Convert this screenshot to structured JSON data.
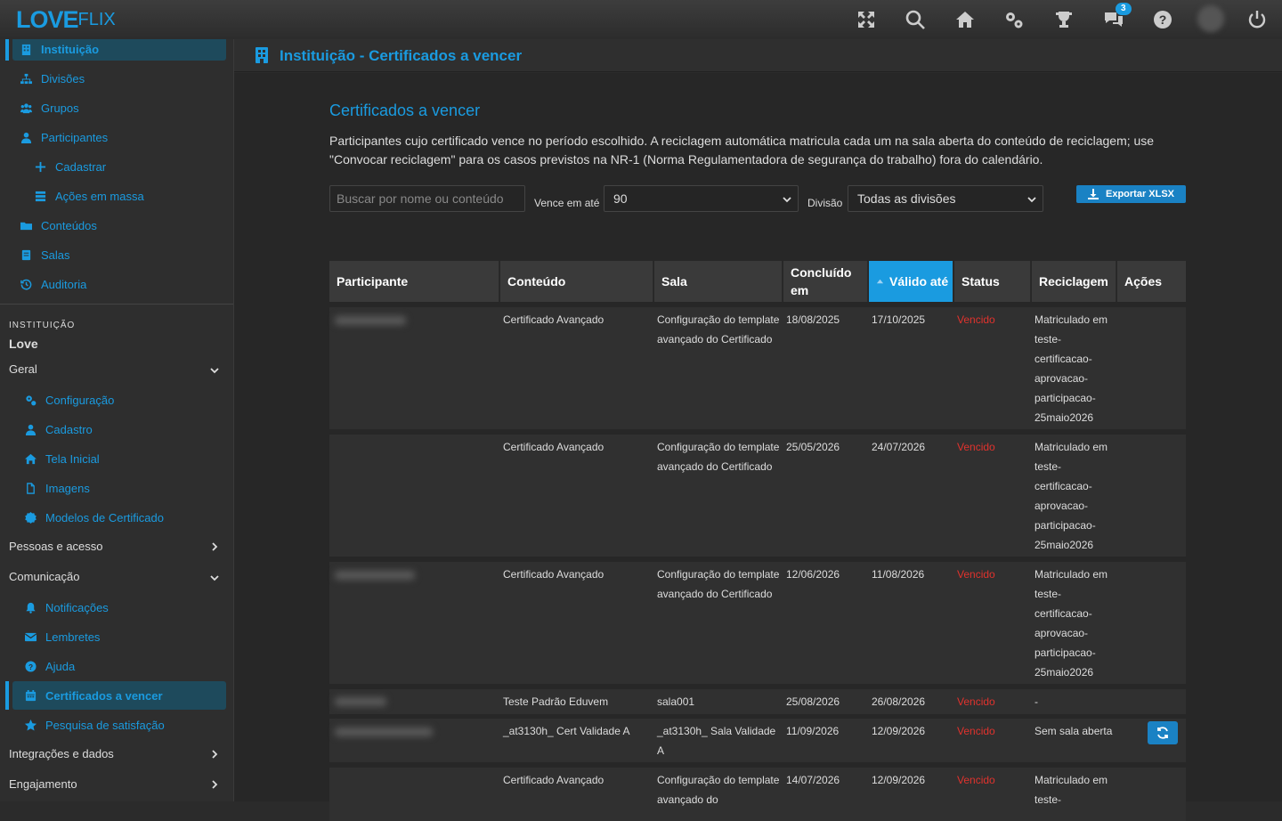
{
  "app": {
    "logo_main": "LOVE",
    "logo_sub": "FLIX",
    "notification_count": "3"
  },
  "topbar": {
    "icons": [
      "fullscreen-icon",
      "search-icon",
      "home-icon",
      "gears-icon",
      "trophy-icon",
      "chat-icon",
      "help-icon",
      "avatar",
      "power-icon"
    ]
  },
  "sidebar": {
    "top_items": [
      {
        "label": "Instituição",
        "icon": "building-icon"
      },
      {
        "label": "Divisões",
        "icon": "sitemap-icon"
      },
      {
        "label": "Grupos",
        "icon": "users-icon"
      },
      {
        "label": "Participantes",
        "icon": "user-icon"
      },
      {
        "label": "Cadastrar",
        "icon": "plus-icon"
      },
      {
        "label": "Ações em massa",
        "icon": "list-icon"
      },
      {
        "label": "Conteúdos",
        "icon": "folder-icon"
      },
      {
        "label": "Salas",
        "icon": "book-icon"
      },
      {
        "label": "Auditoria",
        "icon": "history-icon"
      }
    ],
    "section_caption": "INSTITUIÇÃO",
    "section_name": "Love",
    "groups": {
      "geral": "Geral",
      "pessoas": "Pessoas e acesso",
      "comunicacao": "Comunicação",
      "integracoes": "Integrações e dados",
      "engajamento": "Engajamento"
    },
    "geral_items": [
      {
        "label": "Configuração",
        "icon": "gears-icon"
      },
      {
        "label": "Cadastro",
        "icon": "user-icon"
      },
      {
        "label": "Tela Inicial",
        "icon": "home-icon"
      },
      {
        "label": "Imagens",
        "icon": "file-icon"
      },
      {
        "label": "Modelos de Certificado",
        "icon": "certificate-icon"
      }
    ],
    "comunicacao_items": [
      {
        "label": "Notificações",
        "icon": "bell-icon"
      },
      {
        "label": "Lembretes",
        "icon": "envelope-icon"
      },
      {
        "label": "Ajuda",
        "icon": "help-icon"
      },
      {
        "label": "Certificados a vencer",
        "icon": "calendar-icon"
      },
      {
        "label": "Pesquisa de satisfação",
        "icon": "star-icon"
      }
    ]
  },
  "page": {
    "header": "Instituição - Certificados a vencer",
    "title": "Certificados a vencer",
    "description": "Participantes cujo certificado vence no período escolhido. A reciclagem automática matricula cada um na sala aberta do conteúdo de reciclagem; use \"Convocar reciclagem\" para os casos previstos na NR-1 (Norma Regulamentadora de segurança do trabalho) fora do calendário.",
    "search_placeholder": "Buscar por nome ou conteúdo",
    "vence_label": "Vence em até",
    "vence_value": "90",
    "divisao_label": "Divisão",
    "divisao_value": "Todas as divisões",
    "export_label": "Exportar XLSX"
  },
  "table": {
    "headers": [
      "Participante",
      "Conteúdo",
      "Sala",
      "Concluído em",
      "Válido até",
      "Status",
      "Reciclagem",
      "Ações"
    ],
    "rows": [
      {
        "conteudo": "Certificado Avançado",
        "sala": "Configuração do template avançado do Certificado",
        "concluido": "18/08/2025",
        "valido": "17/10/2025",
        "status": "Vencido",
        "reciclagem": "Matriculado em teste-certificacao-aprovacao-participacao-25maio2026"
      },
      {
        "conteudo": "Certificado Avançado",
        "sala": "Configuração do template avançado do Certificado",
        "concluido": "25/05/2026",
        "valido": "24/07/2026",
        "status": "Vencido",
        "reciclagem": "Matriculado em teste-certificacao-aprovacao-participacao-25maio2026"
      },
      {
        "conteudo": "Certificado Avançado",
        "sala": "Configuração do template avançado do Certificado",
        "concluido": "12/06/2026",
        "valido": "11/08/2026",
        "status": "Vencido",
        "reciclagem": "Matriculado em teste-certificacao-aprovacao-participacao-25maio2026"
      },
      {
        "conteudo": "Teste Padrão Eduvem",
        "sala": "sala001",
        "concluido": "25/08/2026",
        "valido": "26/08/2026",
        "status": "Vencido",
        "reciclagem": "-"
      },
      {
        "conteudo": "_at3130h_ Cert Validade A",
        "sala": "_at3130h_ Sala Validade A",
        "concluido": "11/09/2026",
        "valido": "12/09/2026",
        "status": "Vencido",
        "reciclagem": "Sem sala aberta"
      },
      {
        "conteudo": "Certificado Avançado",
        "sala": "Configuração do template avançado do",
        "concluido": "14/07/2026",
        "valido": "12/09/2026",
        "status": "Vencido",
        "reciclagem": "Matriculado em teste-"
      }
    ]
  }
}
